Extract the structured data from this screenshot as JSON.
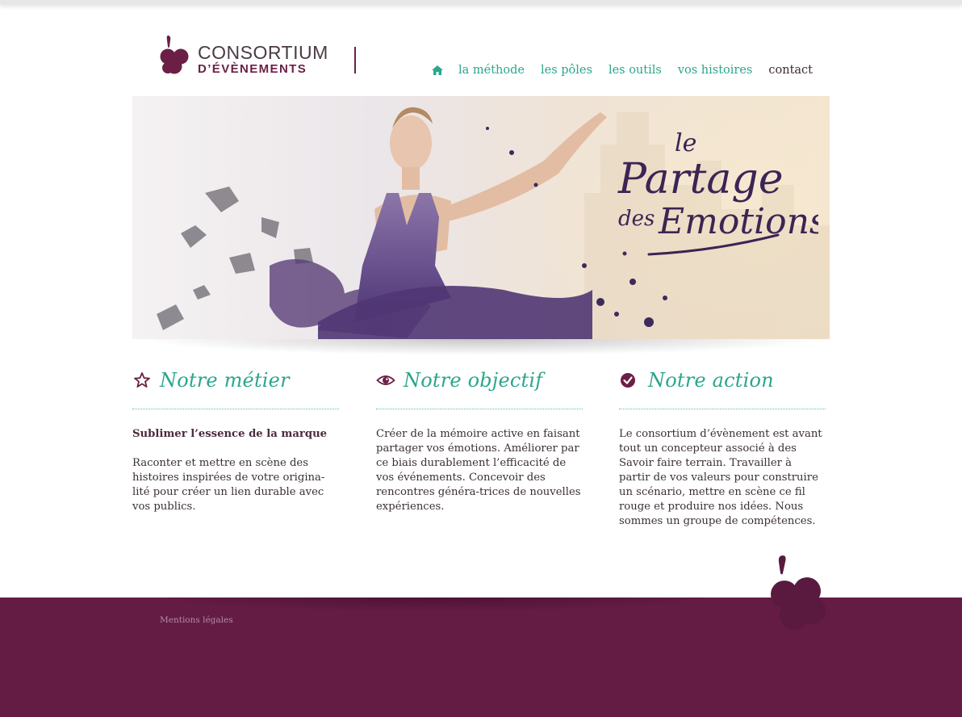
{
  "brand": {
    "name_line1": "CONSORTIUM",
    "name_line2": "D’ÉVÈNEMENTS",
    "primary_color": "#641c45",
    "accent_color": "#2aa68c"
  },
  "nav": {
    "home_icon": "home-icon",
    "items": [
      {
        "label": "la méthode"
      },
      {
        "label": "les pôles"
      },
      {
        "label": "les outils"
      },
      {
        "label": "vos histoires"
      },
      {
        "label": "contact"
      }
    ]
  },
  "hero": {
    "tagline_line1": "le",
    "tagline_line2": "Partage",
    "tagline_line3": "des",
    "tagline_line4": "Emotions"
  },
  "columns": [
    {
      "icon": "star-icon",
      "title": "Notre métier",
      "lead": "Sublimer l’essence de la marque",
      "text": "Raconter et mettre en scène des histoires inspirées de votre origina-lité pour créer un lien durable avec vos publics."
    },
    {
      "icon": "eye-icon",
      "title": "Notre objectif",
      "text": "Créer de la mémoire active  en faisant partager vos émotions. Améliorer par ce biais durablement l’efficacité de vos événements. Concevoir des rencontres généra-trices de nouvelles expériences."
    },
    {
      "icon": "check-circle-icon",
      "title": "Notre action",
      "text": "Le consortium d’évènement est avant tout un concepteur associé à des Savoir faire terrain. Travailler à partir de vos valeurs pour construire un scénario, mettre en scène ce fil rouge et produire nos idées. Nous sommes un groupe de compétences."
    }
  ],
  "footer": {
    "legal_link": "Mentions légales"
  }
}
